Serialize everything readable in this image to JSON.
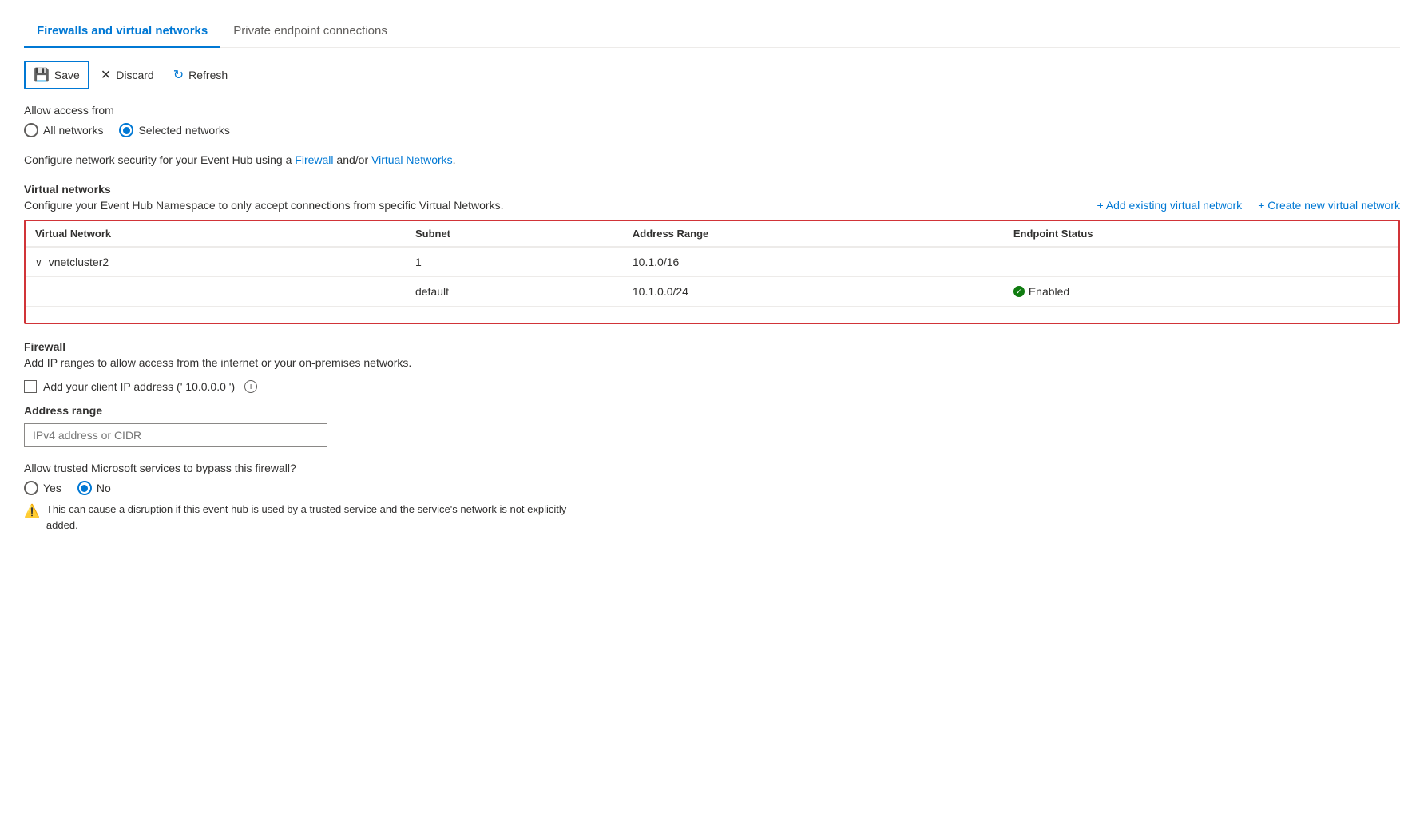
{
  "tabs": [
    {
      "id": "firewalls",
      "label": "Firewalls and virtual networks",
      "active": true
    },
    {
      "id": "private",
      "label": "Private endpoint connections",
      "active": false
    }
  ],
  "toolbar": {
    "save_label": "Save",
    "discard_label": "Discard",
    "refresh_label": "Refresh"
  },
  "access": {
    "label": "Allow access from",
    "options": [
      {
        "id": "all",
        "label": "All networks",
        "selected": false
      },
      {
        "id": "selected",
        "label": "Selected networks",
        "selected": true
      }
    ]
  },
  "description": {
    "text_before": "Configure network security for your Event Hub using a ",
    "link1_label": "Firewall",
    "text_middle": " and/or ",
    "link2_label": "Virtual Networks",
    "text_after": "."
  },
  "virtual_networks": {
    "section_title": "Virtual networks",
    "section_desc": "Configure your Event Hub Namespace to only accept connections from specific Virtual Networks.",
    "add_existing_label": "+ Add existing virtual network",
    "create_new_label": "+ Create new virtual network",
    "columns": [
      {
        "id": "virtual_network",
        "label": "Virtual Network"
      },
      {
        "id": "subnet",
        "label": "Subnet"
      },
      {
        "id": "address_range",
        "label": "Address Range"
      },
      {
        "id": "endpoint_status",
        "label": "Endpoint Status"
      }
    ],
    "rows": [
      {
        "virtual_network": "vnetcluster2",
        "subnet": "1",
        "address_range": "10.1.0/16",
        "endpoint_status": "",
        "is_parent": true
      },
      {
        "virtual_network": "",
        "subnet": "default",
        "address_range": "10.1.0.0/24",
        "endpoint_status": "Enabled",
        "is_parent": false
      }
    ]
  },
  "firewall": {
    "section_title": "Firewall",
    "section_desc": "Add IP ranges to allow access from the internet or your on-premises networks.",
    "client_ip_label": "Add your client IP address (' 10.0.0.0  ')",
    "address_range_label": "Address range",
    "address_placeholder": "IPv4 address or CIDR"
  },
  "trusted": {
    "label": "Allow trusted Microsoft services to bypass this firewall?",
    "options": [
      {
        "id": "yes",
        "label": "Yes",
        "selected": false
      },
      {
        "id": "no",
        "label": "No",
        "selected": true
      }
    ],
    "warning": "This can cause a disruption if this event hub is used by a trusted service and the service's network is not explicitly added."
  }
}
